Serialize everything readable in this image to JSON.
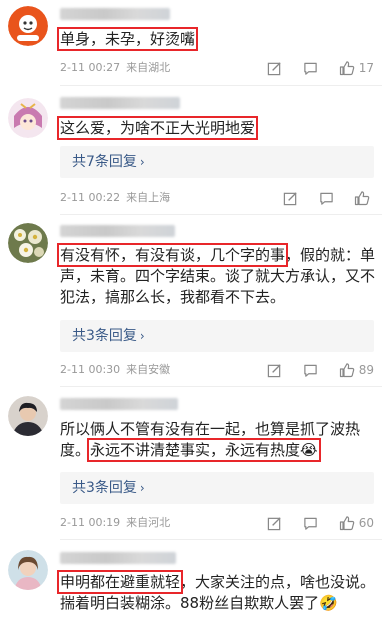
{
  "icons": {
    "edit": "edit-icon",
    "comment": "comment-icon",
    "like": "thumbs-up-icon"
  },
  "comments": [
    {
      "text": [
        {
          "t": "单身，未孕，好烫嘴",
          "hl": true
        }
      ],
      "time": "2-11 00:27",
      "location": "来自湖北",
      "likes": "17"
    },
    {
      "text": [
        {
          "t": "这么爱，为啥不正大光明地爱",
          "hl": true
        }
      ],
      "replies": "共7条回复",
      "time": "2-11 00:22",
      "location": "来自上海",
      "likes": ""
    },
    {
      "text": [
        {
          "t": "有没有怀，有没有谈，几个字的事",
          "hl": true
        },
        {
          "t": "，假的就：单声，未育。四个字结束。谈了就大方承认，又不犯法，搞那么长，我都看不下去。",
          "hl": false
        }
      ],
      "replies": "共3条回复",
      "time": "2-11 00:30",
      "location": "来自安徽",
      "likes": "89"
    },
    {
      "text": [
        {
          "t": "所以俩人不管有没有在一起，也算是抓了波热度。",
          "hl": false
        },
        {
          "t": "永远不讲清楚事实，永远有热度😭",
          "hl": true
        }
      ],
      "replies": "共3条回复",
      "time": "2-11 00:19",
      "location": "来自河北",
      "likes": "60"
    },
    {
      "text": [
        {
          "t": "申明都在避重就轻",
          "hl": true
        },
        {
          "t": "，大家关注的点，啥也没说。揣着明白装糊涂。88粉丝自欺欺人罢了🤣",
          "hl": false
        }
      ]
    }
  ]
}
